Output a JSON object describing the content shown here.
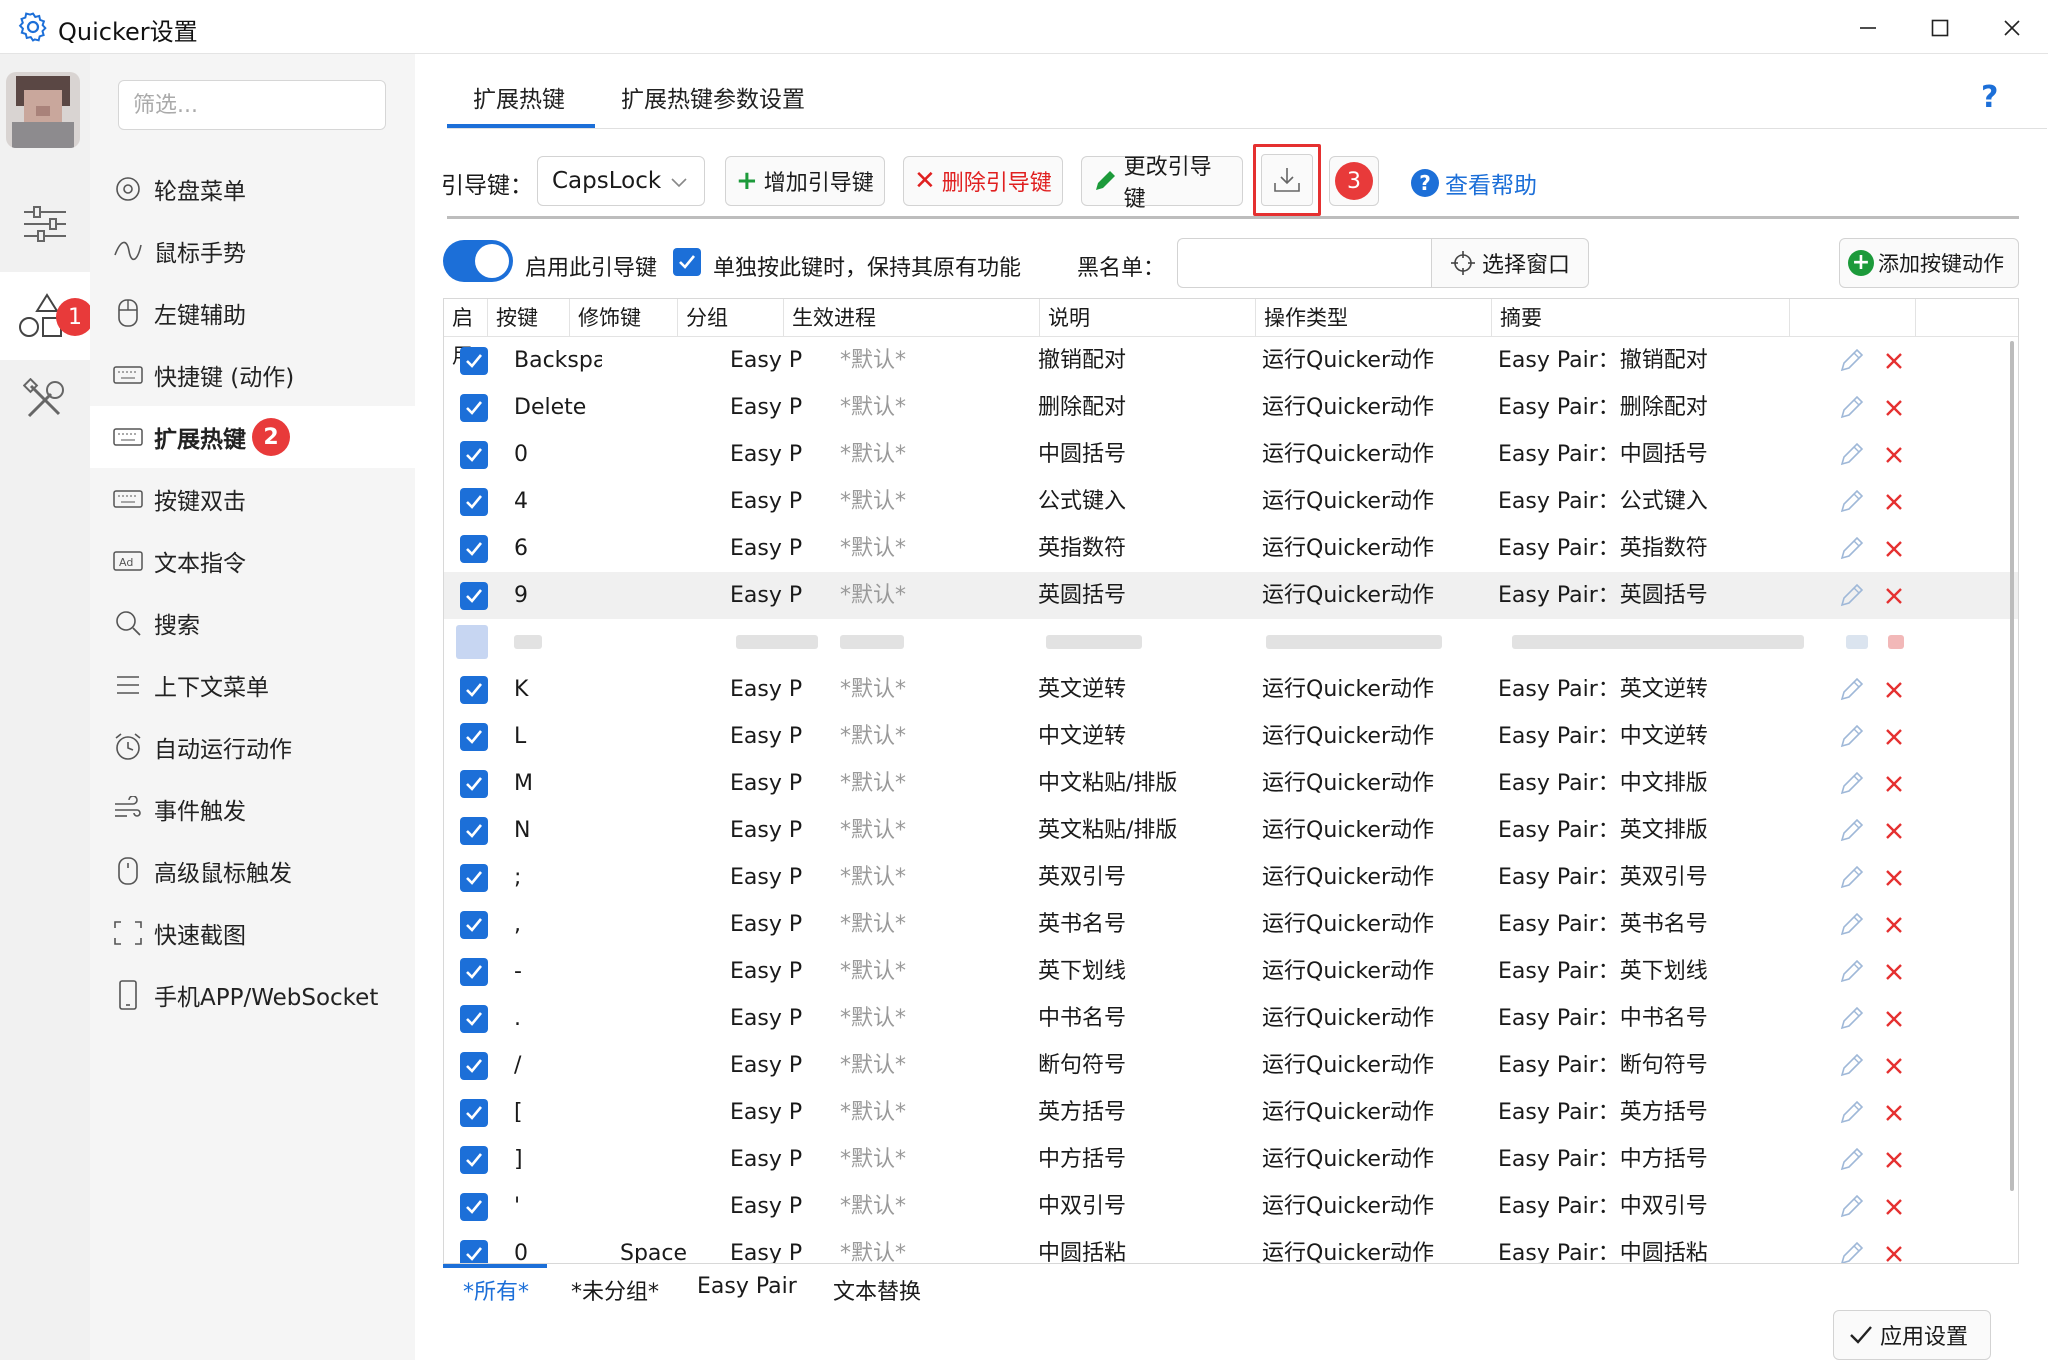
{
  "window": {
    "title": "Quicker设置"
  },
  "rail": {
    "badge1": "1"
  },
  "sidebar": {
    "filter_placeholder": "筛选...",
    "items": [
      {
        "label": "轮盘菜单"
      },
      {
        "label": "鼠标手势"
      },
      {
        "label": "左键辅助"
      },
      {
        "label": "快捷键 (动作)"
      },
      {
        "label": "扩展热键",
        "badge": "2"
      },
      {
        "label": "按键双击"
      },
      {
        "label": "文本指令"
      },
      {
        "label": "搜索"
      },
      {
        "label": "上下文菜单"
      },
      {
        "label": "自动运行动作"
      },
      {
        "label": "事件触发"
      },
      {
        "label": "高级鼠标触发"
      },
      {
        "label": "快速截图"
      },
      {
        "label": "手机APP/WebSocket"
      }
    ]
  },
  "tabs": {
    "ext": "扩展热键",
    "params": "扩展热键参数设置",
    "help_icon": "?"
  },
  "toolbar": {
    "lead_label": "引导键：",
    "lead_value": "CapsLock",
    "add_label": "增加引导键",
    "del_label": "删除引导键",
    "edit_label": "更改引导键",
    "badge3": "3",
    "help_label": "查看帮助"
  },
  "options": {
    "enable_label": "启用此引导键",
    "keep_label": "单独按此键时，保持其原有功能",
    "blacklist_label": "黑名单：",
    "pick_label": "选择窗口",
    "add_action_label": "添加按键动作"
  },
  "table": {
    "headers": [
      "启用",
      "按键",
      "修饰键",
      "分组",
      "生效进程",
      "说明",
      "操作类型",
      "摘要"
    ],
    "rows": [
      {
        "key": "Backspa",
        "mod": "",
        "group": "Easy Pair",
        "proc": "*默认*",
        "desc": "撤销配对",
        "type": "运行Quicker动作",
        "summary": "Easy Pair：撤销配对"
      },
      {
        "key": "Delete",
        "mod": "",
        "group": "Easy Pair",
        "proc": "*默认*",
        "desc": "删除配对",
        "type": "运行Quicker动作",
        "summary": "Easy Pair：删除配对"
      },
      {
        "key": "0",
        "mod": "",
        "group": "Easy Pair",
        "proc": "*默认*",
        "desc": "中圆括号",
        "type": "运行Quicker动作",
        "summary": "Easy Pair：中圆括号"
      },
      {
        "key": "4",
        "mod": "",
        "group": "Easy Pair",
        "proc": "*默认*",
        "desc": "公式键入",
        "type": "运行Quicker动作",
        "summary": "Easy Pair：公式键入"
      },
      {
        "key": "6",
        "mod": "",
        "group": "Easy Pair",
        "proc": "*默认*",
        "desc": "英指数符",
        "type": "运行Quicker动作",
        "summary": "Easy Pair：英指数符"
      },
      {
        "key": "9",
        "mod": "",
        "group": "Easy Pair",
        "proc": "*默认*",
        "desc": "英圆括号",
        "type": "运行Quicker动作",
        "summary": "Easy Pair：英圆括号"
      },
      {
        "key": "",
        "mod": "",
        "group": "",
        "proc": "",
        "desc": "",
        "type": "",
        "summary": ""
      },
      {
        "key": "K",
        "mod": "",
        "group": "Easy Pair",
        "proc": "*默认*",
        "desc": "英文逆转",
        "type": "运行Quicker动作",
        "summary": "Easy Pair：英文逆转"
      },
      {
        "key": "L",
        "mod": "",
        "group": "Easy Pair",
        "proc": "*默认*",
        "desc": "中文逆转",
        "type": "运行Quicker动作",
        "summary": "Easy Pair：中文逆转"
      },
      {
        "key": "M",
        "mod": "",
        "group": "Easy Pair",
        "proc": "*默认*",
        "desc": "中文粘贴/排版",
        "type": "运行Quicker动作",
        "summary": "Easy Pair：中文排版"
      },
      {
        "key": "N",
        "mod": "",
        "group": "Easy Pair",
        "proc": "*默认*",
        "desc": "英文粘贴/排版",
        "type": "运行Quicker动作",
        "summary": "Easy Pair：英文排版"
      },
      {
        "key": ";",
        "mod": "",
        "group": "Easy Pair",
        "proc": "*默认*",
        "desc": "英双引号",
        "type": "运行Quicker动作",
        "summary": "Easy Pair：英双引号"
      },
      {
        "key": ",",
        "mod": "",
        "group": "Easy Pair",
        "proc": "*默认*",
        "desc": "英书名号",
        "type": "运行Quicker动作",
        "summary": "Easy Pair：英书名号"
      },
      {
        "key": "-",
        "mod": "",
        "group": "Easy Pair",
        "proc": "*默认*",
        "desc": "英下划线",
        "type": "运行Quicker动作",
        "summary": "Easy Pair：英下划线"
      },
      {
        "key": ".",
        "mod": "",
        "group": "Easy Pair",
        "proc": "*默认*",
        "desc": "中书名号",
        "type": "运行Quicker动作",
        "summary": "Easy Pair：中书名号"
      },
      {
        "key": "/",
        "mod": "",
        "group": "Easy Pair",
        "proc": "*默认*",
        "desc": "断句符号",
        "type": "运行Quicker动作",
        "summary": "Easy Pair：断句符号"
      },
      {
        "key": "[",
        "mod": "",
        "group": "Easy Pair",
        "proc": "*默认*",
        "desc": "英方括号",
        "type": "运行Quicker动作",
        "summary": "Easy Pair：英方括号"
      },
      {
        "key": "]",
        "mod": "",
        "group": "Easy Pair",
        "proc": "*默认*",
        "desc": "中方括号",
        "type": "运行Quicker动作",
        "summary": "Easy Pair：中方括号"
      },
      {
        "key": "'",
        "mod": "",
        "group": "Easy Pair",
        "proc": "*默认*",
        "desc": "中双引号",
        "type": "运行Quicker动作",
        "summary": "Easy Pair：中双引号"
      },
      {
        "key": "0",
        "mod": "Space",
        "group": "Easy Pair",
        "proc": "*默认*",
        "desc": "中圆括粘",
        "type": "运行Quicker动作",
        "summary": "Easy Pair：中圆括粘"
      }
    ]
  },
  "groups": {
    "all": "*所有*",
    "none": "*未分组*",
    "easy": "Easy Pair",
    "text": "文本替换"
  },
  "footer": {
    "apply_label": "应用设置"
  },
  "colors": {
    "accent": "#1c6fd8",
    "danger": "#e02020",
    "add_green": "#1c9a3a"
  }
}
